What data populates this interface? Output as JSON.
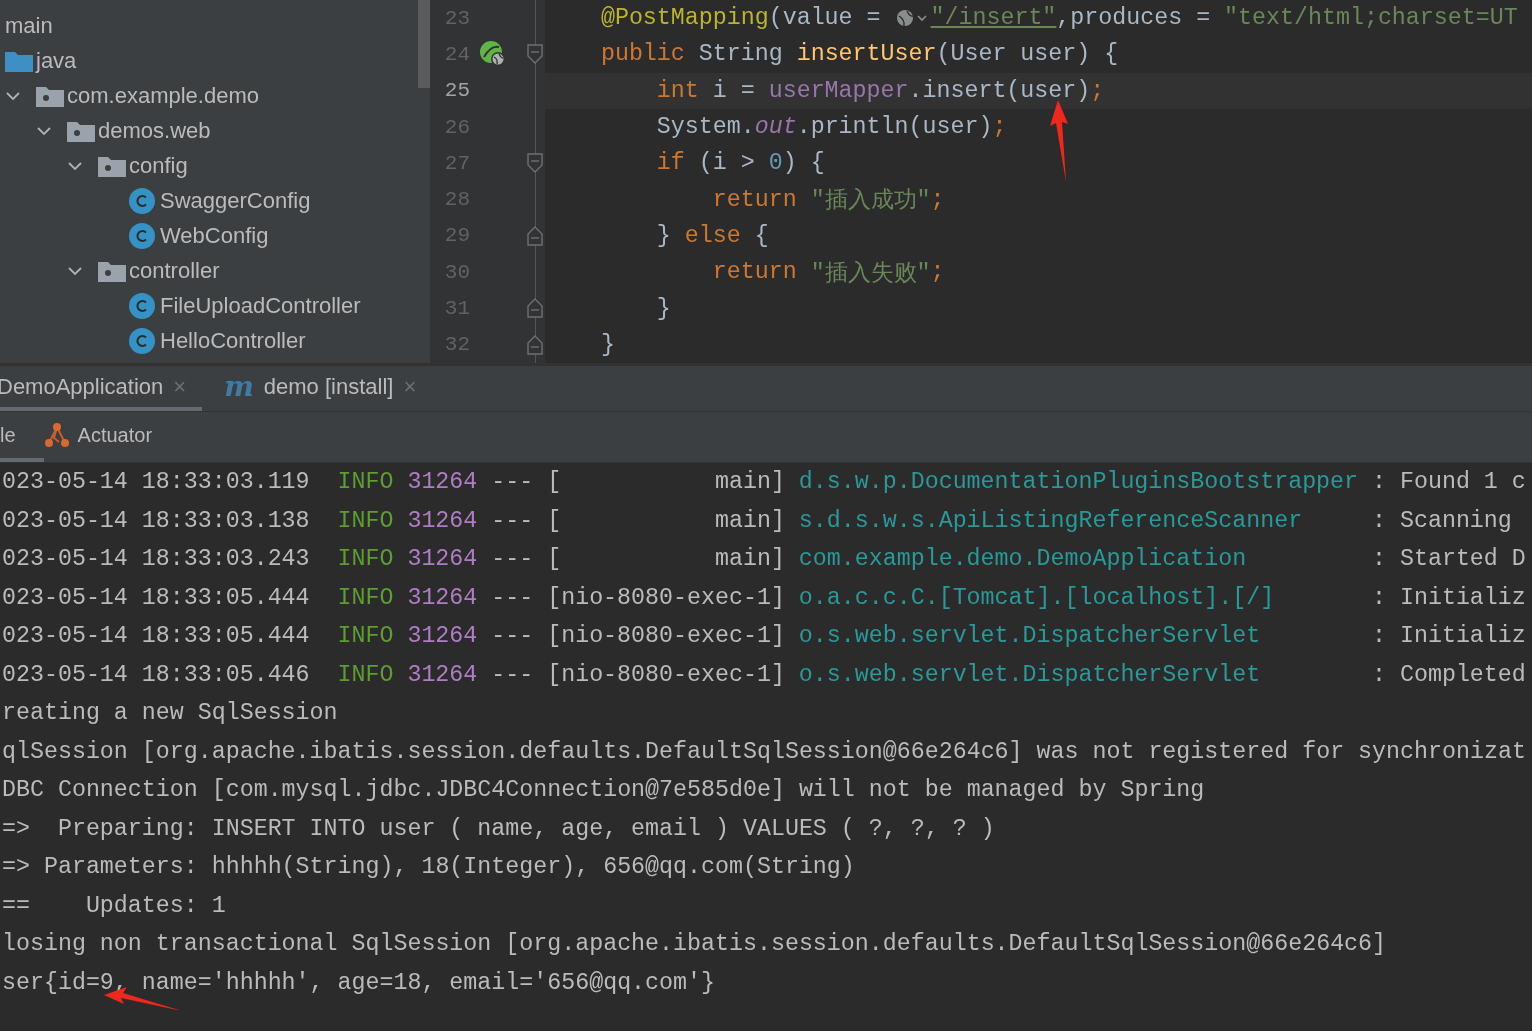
{
  "project_tree": [
    {
      "label": "main",
      "children": [
        {
          "label": "java",
          "kind": "source-folder",
          "children": [
            {
              "label": "com.example.demo",
              "kind": "package",
              "expanded": true,
              "children": [
                {
                  "label": "demos.web",
                  "kind": "package",
                  "expanded": true,
                  "children": [
                    {
                      "label": "config",
                      "kind": "package",
                      "expanded": true,
                      "children": [
                        {
                          "label": "SwaggerConfig",
                          "kind": "class"
                        },
                        {
                          "label": "WebConfig",
                          "kind": "class"
                        }
                      ]
                    },
                    {
                      "label": "controller",
                      "kind": "package",
                      "expanded": true,
                      "children": [
                        {
                          "label": "FileUploadController",
                          "kind": "class"
                        },
                        {
                          "label": "HelloController",
                          "kind": "class"
                        }
                      ]
                    }
                  ]
                }
              ]
            }
          ]
        }
      ]
    }
  ],
  "editor": {
    "lines": [
      {
        "number": "23",
        "current": false,
        "bean_marker": false,
        "fold_start": false,
        "fold_end": false,
        "tokens": [
          {
            "kind": "annotation",
            "text": "    @PostMapping"
          },
          {
            "kind": "plain",
            "text": "(value = "
          },
          {
            "kind": "url-icon"
          },
          {
            "kind": "link-string",
            "text": "\"/insert\""
          },
          {
            "kind": "plain",
            "text": ",produces = "
          },
          {
            "kind": "string",
            "text": "\"text/html;charset=UT"
          }
        ]
      },
      {
        "number": "24",
        "current": false,
        "bean_marker": true,
        "fold_start": true,
        "fold_end": false,
        "tokens": [
          {
            "kind": "keyword",
            "text": "    public "
          },
          {
            "kind": "plain",
            "text": "String "
          },
          {
            "kind": "method",
            "text": "insertUser"
          },
          {
            "kind": "plain",
            "text": "(User user) {"
          }
        ]
      },
      {
        "number": "25",
        "current": true,
        "bean_marker": false,
        "fold_start": false,
        "fold_end": false,
        "tokens": [
          {
            "kind": "keyword",
            "text": "        int "
          },
          {
            "kind": "plain",
            "text": "i = "
          },
          {
            "kind": "field",
            "text": "userMapper"
          },
          {
            "kind": "plain",
            "text": ".insert(user)"
          },
          {
            "kind": "keyword",
            "text": ";"
          }
        ]
      },
      {
        "number": "26",
        "current": false,
        "bean_marker": false,
        "fold_start": false,
        "fold_end": false,
        "tokens": [
          {
            "kind": "plain",
            "text": "        System."
          },
          {
            "kind": "static",
            "text": "out"
          },
          {
            "kind": "plain",
            "text": ".println(user)"
          },
          {
            "kind": "keyword",
            "text": ";"
          }
        ]
      },
      {
        "number": "27",
        "current": false,
        "bean_marker": false,
        "fold_start": true,
        "fold_end": false,
        "tokens": [
          {
            "kind": "keyword",
            "text": "        if "
          },
          {
            "kind": "plain",
            "text": "(i > "
          },
          {
            "kind": "number",
            "text": "0"
          },
          {
            "kind": "plain",
            "text": ") {"
          }
        ]
      },
      {
        "number": "28",
        "current": false,
        "bean_marker": false,
        "fold_start": false,
        "fold_end": false,
        "tokens": [
          {
            "kind": "keyword",
            "text": "            return "
          },
          {
            "kind": "string",
            "text": "\"插入成功\""
          },
          {
            "kind": "keyword",
            "text": ";"
          }
        ]
      },
      {
        "number": "29",
        "current": false,
        "bean_marker": false,
        "fold_start": false,
        "fold_end": true,
        "tokens": [
          {
            "kind": "plain",
            "text": "        } "
          },
          {
            "kind": "keyword",
            "text": "else "
          },
          {
            "kind": "plain",
            "text": "{"
          }
        ]
      },
      {
        "number": "30",
        "current": false,
        "bean_marker": false,
        "fold_start": false,
        "fold_end": false,
        "tokens": [
          {
            "kind": "keyword",
            "text": "            return "
          },
          {
            "kind": "string",
            "text": "\"插入失败\""
          },
          {
            "kind": "keyword",
            "text": ";"
          }
        ]
      },
      {
        "number": "31",
        "current": false,
        "bean_marker": false,
        "fold_start": false,
        "fold_end": true,
        "tokens": [
          {
            "kind": "plain",
            "text": "        }"
          }
        ]
      },
      {
        "number": "32",
        "current": false,
        "bean_marker": false,
        "fold_start": false,
        "fold_end": true,
        "tokens": [
          {
            "kind": "plain",
            "text": "    }"
          }
        ]
      }
    ]
  },
  "run_tabs": [
    {
      "label": "DemoApplication",
      "close": "×",
      "selected": true
    },
    {
      "icon_text": "m",
      "label": "demo [install]",
      "close": "×",
      "selected": false
    }
  ],
  "console_tabs": [
    {
      "kind": "plain",
      "label": "le",
      "selected": true
    },
    {
      "kind": "with-icon",
      "label": "Actuator",
      "selected": false
    }
  ],
  "console": [
    {
      "kind": "log",
      "date": "023-05-14 18:33:03.119",
      "level": "INFO",
      "pid": "31264",
      "dashes": "---",
      "thread": "[           main]",
      "logger": "d.s.w.p.DocumentationPluginsBootstrapper",
      "colon": ":",
      "message": "Found 1 c"
    },
    {
      "kind": "log",
      "date": "023-05-14 18:33:03.138",
      "level": "INFO",
      "pid": "31264",
      "dashes": "---",
      "thread": "[           main]",
      "logger": "s.d.s.w.s.ApiListingReferenceScanner",
      "colon": ":",
      "message": "Scanning"
    },
    {
      "kind": "log",
      "date": "023-05-14 18:33:03.243",
      "level": "INFO",
      "pid": "31264",
      "dashes": "---",
      "thread": "[           main]",
      "logger": "com.example.demo.DemoApplication",
      "colon": ":",
      "message": "Started D"
    },
    {
      "kind": "log",
      "date": "023-05-14 18:33:05.444",
      "level": "INFO",
      "pid": "31264",
      "dashes": "---",
      "thread": "[nio-8080-exec-1]",
      "logger": "o.a.c.c.C.[Tomcat].[localhost].[/]",
      "colon": ":",
      "message": "Initializ"
    },
    {
      "kind": "log",
      "date": "023-05-14 18:33:05.444",
      "level": "INFO",
      "pid": "31264",
      "dashes": "---",
      "thread": "[nio-8080-exec-1]",
      "logger": "o.s.web.servlet.DispatcherServlet",
      "colon": ":",
      "message": "Initializ"
    },
    {
      "kind": "log",
      "date": "023-05-14 18:33:05.446",
      "level": "INFO",
      "pid": "31264",
      "dashes": "---",
      "thread": "[nio-8080-exec-1]",
      "logger": "o.s.web.servlet.DispatcherServlet",
      "colon": ":",
      "message": "Completed"
    },
    {
      "kind": "text",
      "text": "reating a new SqlSession"
    },
    {
      "kind": "text",
      "text": "qlSession [org.apache.ibatis.session.defaults.DefaultSqlSession@66e264c6] was not registered for synchronizat"
    },
    {
      "kind": "text",
      "text": "DBC Connection [com.mysql.jdbc.JDBC4Connection@7e585d0e] will not be managed by Spring"
    },
    {
      "kind": "text",
      "text": "=>  Preparing: INSERT INTO user ( name, age, email ) VALUES ( ?, ?, ? )"
    },
    {
      "kind": "text",
      "text": "=> Parameters: hhhhh(String), 18(Integer), 656@qq.com(String)"
    },
    {
      "kind": "text",
      "text": "==    Updates: 1"
    },
    {
      "kind": "text",
      "text": "losing non transactional SqlSession [org.apache.ibatis.session.defaults.DefaultSqlSession@66e264c6]"
    },
    {
      "kind": "text",
      "text": "ser{id=9, name='hhhhh', age=18, email='656@qq.com'}"
    }
  ]
}
